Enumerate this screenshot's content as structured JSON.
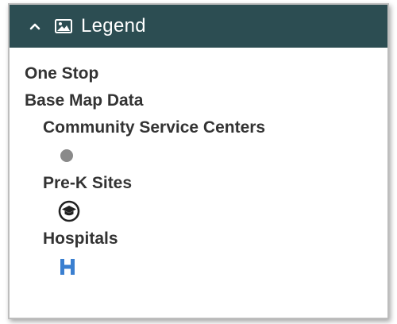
{
  "legend": {
    "title": "Legend",
    "icons": {
      "collapse": "chevron-up-icon",
      "header": "image-icon"
    },
    "colors": {
      "header_bg": "#2c4d52",
      "header_text": "#ffffff",
      "text": "#333333",
      "community_dot": "#8a8a8a",
      "prek_icon": "#222222",
      "hospital_icon": "#3a7fd0"
    },
    "layers": [
      {
        "label": "One Stop"
      },
      {
        "label": "Base Map Data",
        "sublayers": [
          {
            "label": "Community Service Centers",
            "symbol": "gray-circle-icon"
          },
          {
            "label": "Pre-K Sites",
            "symbol": "graduation-cap-icon"
          },
          {
            "label": "Hospitals",
            "symbol": "hospital-h-icon"
          }
        ]
      }
    ]
  }
}
